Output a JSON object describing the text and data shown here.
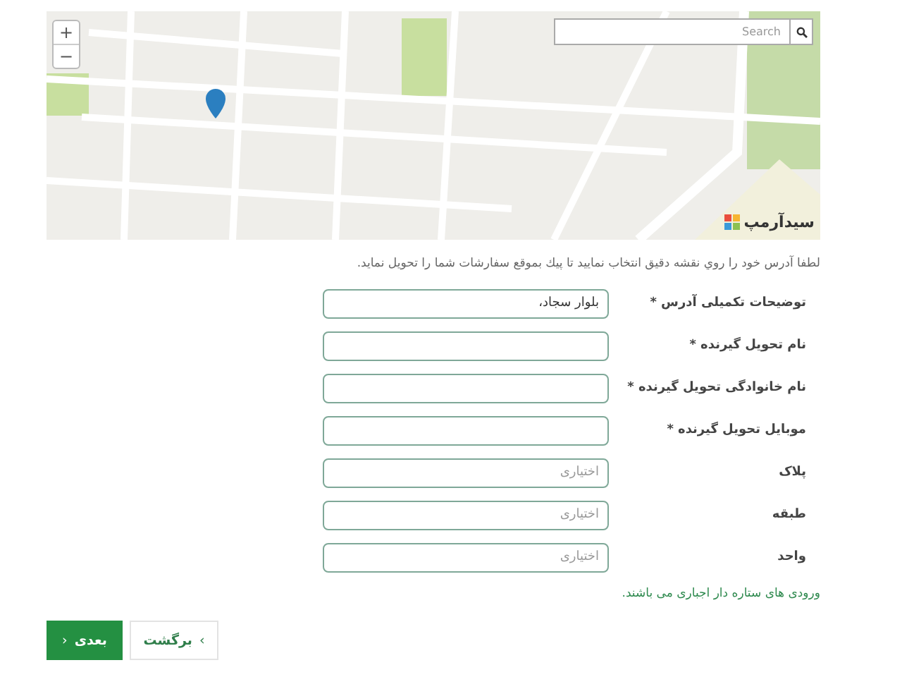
{
  "map": {
    "zoom_in": "+",
    "zoom_out": "−",
    "search": {
      "placeholder": "Search"
    },
    "logo": "سیدآرمپ"
  },
  "instruction": "لطفا آدرس خود را روي نقشه دقيق انتخاب نماييد تا پيك بموقع سفارشات شما را تحويل نمايد.",
  "fields": [
    {
      "label": "توضیحات تکمیلی آدرس *",
      "value": "بلوار سجاد،"
    },
    {
      "label": "نام تحویل گیرنده *"
    },
    {
      "label": "نام خانوادگی تحویل گیرنده *"
    },
    {
      "label": "موبایل تحویل گیرنده *"
    },
    {
      "label": "پلاک",
      "placeholder": "اختیاری"
    },
    {
      "label": "طبقه",
      "placeholder": "اختیاری"
    },
    {
      "label": "واحد",
      "placeholder": "اختیاری"
    }
  ],
  "note": "ورودی های ستاره دار اجباری می باشند.",
  "buttons": {
    "back": {
      "label": "برگشت",
      "icon": "‹"
    },
    "next": {
      "label": "بعدی",
      "icon": "›"
    }
  }
}
